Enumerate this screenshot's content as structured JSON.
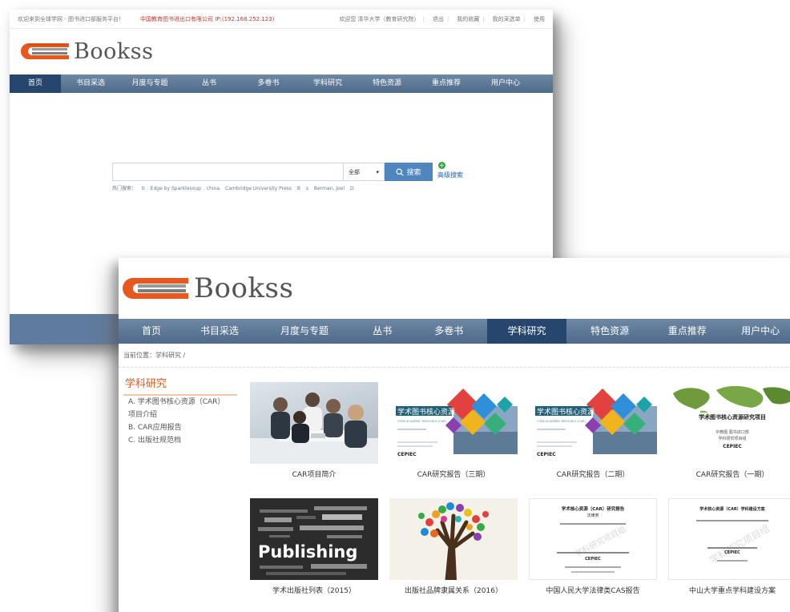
{
  "back": {
    "topbar": {
      "welcome": "欢迎来到全球学网 - 图书进口部服务平台！",
      "company_ip": "中国教育图书进出口有限公司 IP:(192.168.252.123)",
      "greeting": "欢迎您  清华大学（教育研究院）",
      "links": [
        "退出",
        "我的收藏",
        "我的采选单",
        "使用"
      ]
    },
    "logo_text": "Bookss",
    "nav": [
      "首页",
      "书目采选",
      "月度与专题",
      "丛书",
      "多卷书",
      "学科研究",
      "特色资源",
      "重点推荐",
      "用户中心"
    ],
    "search": {
      "placeholder": "",
      "scope": "全部",
      "button": "搜索",
      "advanced": "高级搜索",
      "hot_label": "热门搜索：",
      "hot_terms": [
        "b",
        "Edge by Sparklesoup",
        "china",
        "Cambridge University Press",
        "B",
        "s",
        "Berman, Joel",
        "D"
      ]
    }
  },
  "front": {
    "logo_text": "Bookss",
    "nav": [
      "首页",
      "书目采选",
      "月度与专题",
      "丛书",
      "多卷书",
      "学科研究",
      "特色资源",
      "重点推荐",
      "用户中心"
    ],
    "breadcrumb": "当前位置：学科研究 /",
    "sidebar": {
      "title": "学科研究",
      "items": [
        "A. 学术图书核心资源（CAR）",
        "项目介绍",
        "B. CAR应用报告",
        "C. 出版社规范档"
      ]
    },
    "thumb_text": {
      "car_title": "学术图书核心资源",
      "car_subtitle": "CORE ACADEMIC RESOURCE (CAR)",
      "cepiec": "CEPIEC",
      "map_title": "学术图书核心资源研究项目",
      "map_org": "中教图 图书进口部",
      "map_team": "学科研究项目组",
      "publishing": "Publishing",
      "doc1_title": "学术核心资源（CAR）研究报告",
      "doc1_sub": "法律类",
      "doc2_title": "学术核心资源（CAR）学科建设方案",
      "watermark": "学科研究项目组"
    },
    "cards": [
      {
        "caption": "CAR项目简介",
        "thumb": "meeting"
      },
      {
        "caption": "CAR研究报告（三期）",
        "thumb": "report"
      },
      {
        "caption": "CAR研究报告（二期）",
        "thumb": "report"
      },
      {
        "caption": "CAR研究报告（一期）",
        "thumb": "map"
      },
      {
        "caption": "学术出版社列表（2015）",
        "thumb": "publishing"
      },
      {
        "caption": "出版社品牌隶属关系（2016）",
        "thumb": "tree"
      },
      {
        "caption": "中国人民大学法律类CAS报告",
        "thumb": "doc"
      },
      {
        "caption": "中山大学重点学科建设方案",
        "thumb": "doc"
      }
    ]
  },
  "colors": {
    "nav_bg": "#5f7b9e",
    "nav_active": "#27466e",
    "accent_orange": "#e05a1c",
    "search_button": "#4f86bd"
  }
}
